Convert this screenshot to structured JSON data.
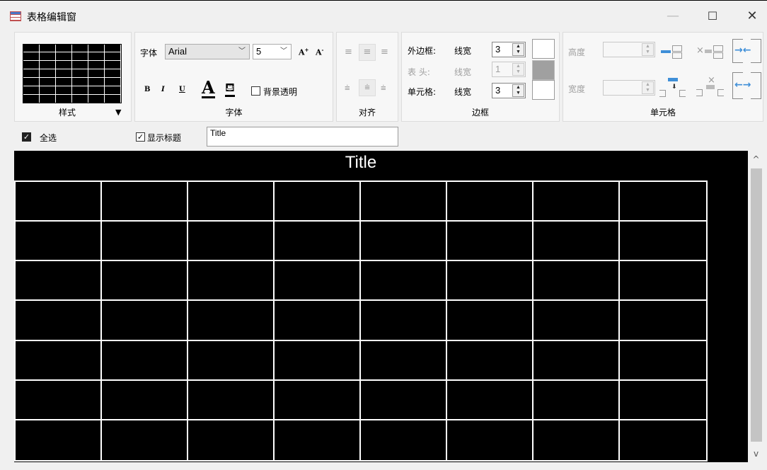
{
  "window": {
    "title": "表格编辑窗",
    "icon": "table-icon",
    "controls": {
      "minimize": "—",
      "maximize": "☐",
      "close": "✕"
    }
  },
  "ribbon": {
    "style_group": {
      "label": "样式",
      "dropdown_icon": "▼"
    },
    "font_group": {
      "label": "字体",
      "font_label": "字体",
      "font_family": "Arial",
      "font_size": "5",
      "bold": "B",
      "italic": "I",
      "underline": "U",
      "font_color": "A",
      "bg_transparent_label": "背景透明",
      "bg_transparent_checked": false
    },
    "align_group": {
      "label": "对齐"
    },
    "border_group": {
      "label": "边框",
      "outer_label": "外边框:",
      "outer_width_label": "线宽",
      "outer_width": "3",
      "outer_color": "#ffffff",
      "header_label": "表 头:",
      "header_width_label": "线宽",
      "header_width": "1",
      "header_color": "#a0a0a0",
      "cell_label": "单元格:",
      "cell_width_label": "线宽",
      "cell_width": "3",
      "cell_color": "#ffffff"
    },
    "cell_group": {
      "label": "单元格",
      "height_label": "高度",
      "height_value": "",
      "width_label": "宽度",
      "width_value": ""
    }
  },
  "options": {
    "select_all_label": "全选",
    "select_all_checked": true,
    "show_title_label": "显示标题",
    "show_title_checked": true,
    "title_input_value": "Title"
  },
  "table": {
    "title": "Title",
    "rows": 7,
    "columns": 8,
    "background": "#000000",
    "line_color": "#ffffff"
  },
  "scrollbar": {
    "up": "^",
    "down": "v"
  }
}
